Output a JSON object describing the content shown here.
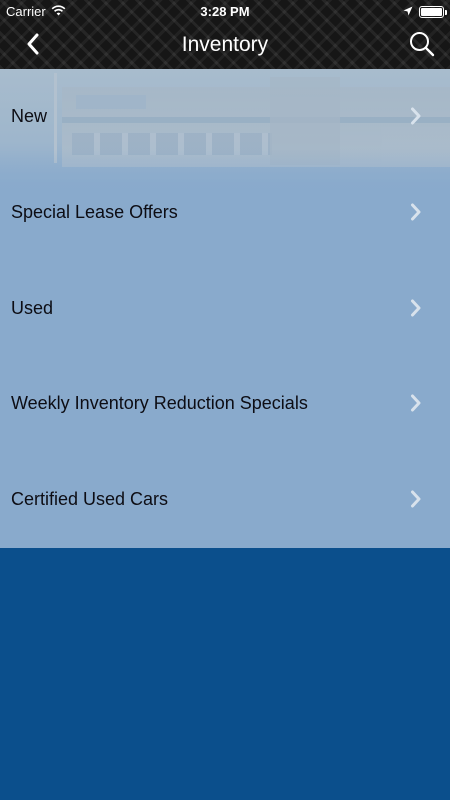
{
  "status_bar": {
    "carrier": "Carrier",
    "time": "3:28 PM",
    "icons": [
      "wifi-icon",
      "location-arrow-icon",
      "battery-icon"
    ]
  },
  "nav_bar": {
    "title": "Inventory",
    "back_icon": "chevron-left-icon",
    "search_icon": "search-icon"
  },
  "menu": {
    "items": [
      {
        "label": "New"
      },
      {
        "label": "Special Lease Offers"
      },
      {
        "label": "Used"
      },
      {
        "label": "Weekly Inventory Reduction Specials"
      },
      {
        "label": "Certified Used Cars"
      }
    ],
    "chevron_icon": "chevron-right-icon"
  },
  "colors": {
    "header_bg": "#161616",
    "list_bg": "#89aacc",
    "footer_bg": "#0b4f8c",
    "text": "#0d0d14",
    "chevron": "#d8e2ec"
  }
}
